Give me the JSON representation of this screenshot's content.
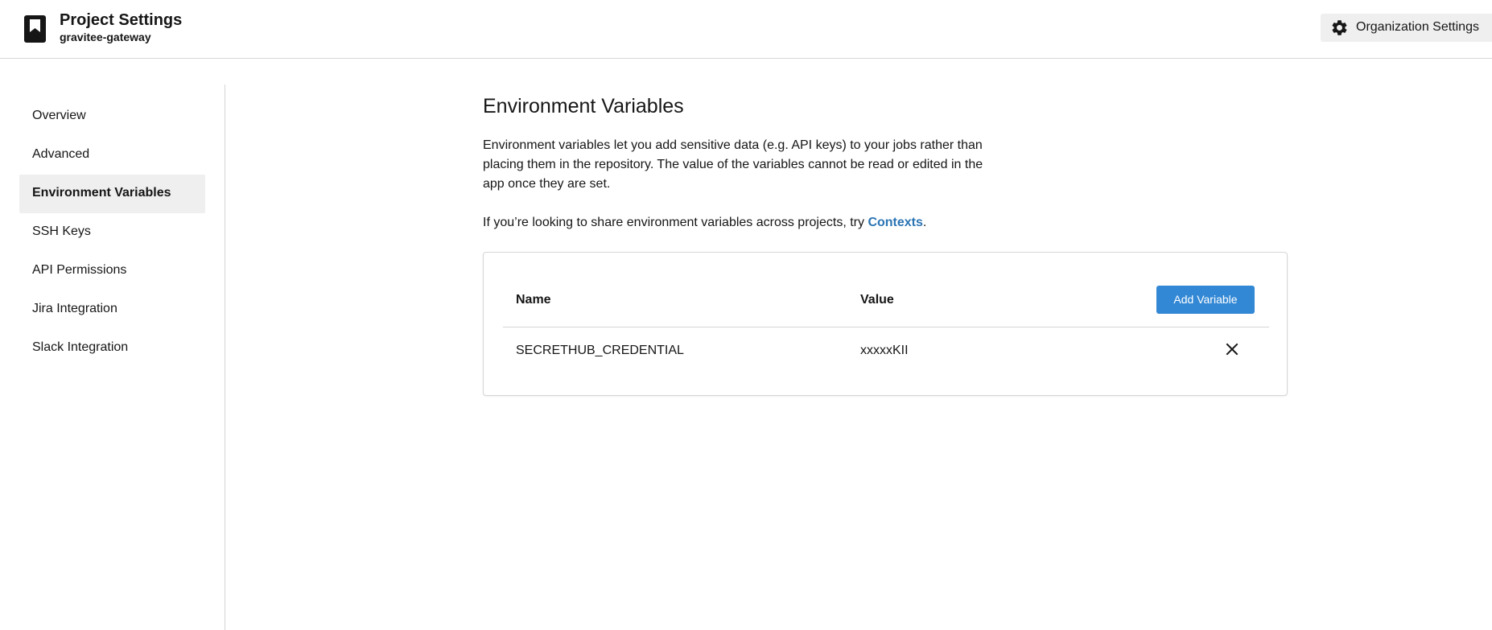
{
  "header": {
    "title": "Project Settings",
    "subtitle": "gravitee-gateway",
    "project_icon": "bookmark-icon",
    "org_settings_label": "Organization Settings",
    "org_settings_icon": "gear-icon"
  },
  "sidebar": {
    "items": [
      {
        "label": "Overview",
        "active": false
      },
      {
        "label": "Advanced",
        "active": false
      },
      {
        "label": "Environment Variables",
        "active": true
      },
      {
        "label": "SSH Keys",
        "active": false
      },
      {
        "label": "API Permissions",
        "active": false
      },
      {
        "label": "Jira Integration",
        "active": false
      },
      {
        "label": "Slack Integration",
        "active": false
      }
    ]
  },
  "main": {
    "title": "Environment Variables",
    "description": "Environment variables let you add sensitive data (e.g. API keys) to your jobs rather than placing them in the repository. The value of the variables cannot be read or edited in the app once they are set.",
    "share_text": "If you’re looking to share environment variables across projects, try ",
    "share_link": "Contexts",
    "share_suffix": "."
  },
  "table": {
    "columns": {
      "name": "Name",
      "value": "Value"
    },
    "add_button_label": "Add Variable",
    "rows": [
      {
        "name": "SECRETHUB_CREDENTIAL",
        "value": "xxxxxKII",
        "delete_icon": "close-icon"
      }
    ]
  },
  "colors": {
    "accent": "#3288d5",
    "link": "#2a74b4",
    "active_bg": "#efefef",
    "border": "#d6d6d6"
  }
}
